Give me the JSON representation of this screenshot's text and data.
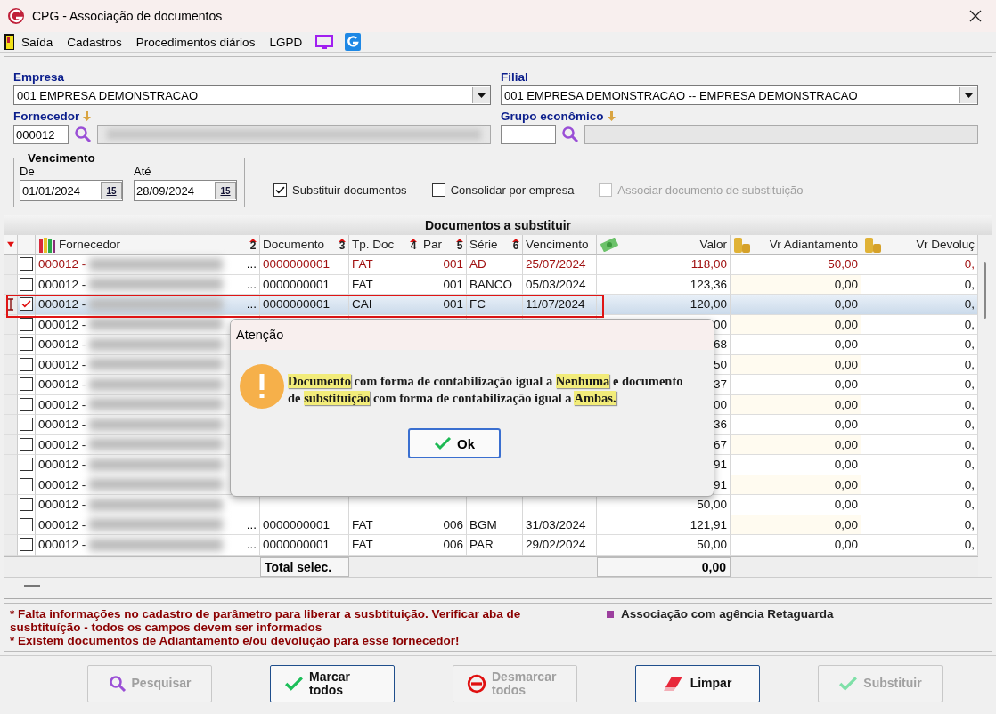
{
  "window": {
    "title": "CPG - Associação de documentos"
  },
  "menu": [
    {
      "label": "Saída"
    },
    {
      "label": "Cadastros"
    },
    {
      "label": "Procedimentos diários"
    },
    {
      "label": "LGPD"
    }
  ],
  "form": {
    "empresa": {
      "label": "Empresa",
      "value": "001 EMPRESA DEMONSTRACAO"
    },
    "filial": {
      "label": "Filial",
      "value": "001 EMPRESA DEMONSTRACAO -- EMPRESA DEMONSTRACAO"
    },
    "fornecedor": {
      "label": "Fornecedor",
      "code": "000012"
    },
    "grupo": {
      "label": "Grupo econômico"
    },
    "vencimento": {
      "title": "Vencimento",
      "de_label": "De",
      "de": "01/01/2024",
      "de_calendar": "15",
      "ate_label": "Até",
      "ate": "28/09/2024",
      "ate_calendar": "15"
    },
    "options": [
      {
        "label": "Substituir documentos",
        "checked": true,
        "disabled": false
      },
      {
        "label": "Consolidar por empresa",
        "checked": false,
        "disabled": false
      },
      {
        "label": "Associar documento de substituição",
        "checked": false,
        "disabled": true
      }
    ]
  },
  "grid": {
    "title": "Documentos a substituir",
    "columns": [
      {
        "label": "Fornecedor",
        "sort": "2"
      },
      {
        "label": "Documento",
        "sort": "3"
      },
      {
        "label": "Tp. Doc",
        "sort": "4"
      },
      {
        "label": "Par",
        "sort": "5"
      },
      {
        "label": "Série",
        "sort": "6"
      },
      {
        "label": "Vencimento"
      },
      {
        "label": "Valor"
      },
      {
        "label": "Vr Adiantamento"
      },
      {
        "label": "Vr Devoluç"
      }
    ],
    "rows": [
      {
        "checked": false,
        "selected": false,
        "alert": true,
        "fornecedor": "000012 -",
        "more": "...",
        "documento": "0000000001",
        "tp_doc": "FAT",
        "par": "001",
        "serie": "AD",
        "vencimento": "25/07/2024",
        "valor": "118,00",
        "vr_adiantamento": "50,00",
        "vr_devolucao": "0,"
      },
      {
        "checked": false,
        "selected": false,
        "alert": false,
        "fornecedor": "000012 -",
        "more": "...",
        "documento": "0000000001",
        "tp_doc": "FAT",
        "par": "001",
        "serie": "BANCO",
        "vencimento": "05/03/2024",
        "valor": "123,36",
        "vr_adiantamento": "0,00",
        "vr_devolucao": "0,"
      },
      {
        "checked": true,
        "selected": true,
        "alert": false,
        "fornecedor": "000012 -",
        "more": "...",
        "documento": "0000000001",
        "tp_doc": "CAI",
        "par": "001",
        "serie": "FC",
        "vencimento": "11/07/2024",
        "valor": "120,00",
        "vr_adiantamento": "0,00",
        "vr_devolucao": "0,"
      },
      {
        "checked": false,
        "selected": false,
        "alert": false,
        "fornecedor": "000012 -",
        "valor": "00",
        "vr_adiantamento": "0,00",
        "vr_devolucao": "0,"
      },
      {
        "checked": false,
        "selected": false,
        "alert": false,
        "fornecedor": "000012 -",
        "valor": "68",
        "vr_adiantamento": "0,00",
        "vr_devolucao": "0,"
      },
      {
        "checked": false,
        "selected": false,
        "alert": false,
        "fornecedor": "000012 -",
        "valor": "50",
        "vr_adiantamento": "0,00",
        "vr_devolucao": "0,"
      },
      {
        "checked": false,
        "selected": false,
        "alert": false,
        "fornecedor": "000012 -",
        "valor": "37",
        "vr_adiantamento": "0,00",
        "vr_devolucao": "0,"
      },
      {
        "checked": false,
        "selected": false,
        "alert": false,
        "fornecedor": "000012 -",
        "valor": "00",
        "vr_adiantamento": "0,00",
        "vr_devolucao": "0,"
      },
      {
        "checked": false,
        "selected": false,
        "alert": false,
        "fornecedor": "000012 -",
        "valor": "36",
        "vr_adiantamento": "0,00",
        "vr_devolucao": "0,"
      },
      {
        "checked": false,
        "selected": false,
        "alert": false,
        "fornecedor": "000012 -",
        "valor": "67",
        "vr_adiantamento": "0,00",
        "vr_devolucao": "0,"
      },
      {
        "checked": false,
        "selected": false,
        "alert": false,
        "fornecedor": "000012 -",
        "valor": "91",
        "vr_adiantamento": "0,00",
        "vr_devolucao": "0,"
      },
      {
        "checked": false,
        "selected": false,
        "alert": false,
        "fornecedor": "000012 -",
        "valor": "91",
        "vr_adiantamento": "0,00",
        "vr_devolucao": "0,"
      },
      {
        "checked": false,
        "selected": false,
        "alert": false,
        "fornecedor": "000012 -",
        "valor": "50,00",
        "vr_adiantamento": "0,00",
        "vr_devolucao": "0,"
      },
      {
        "checked": false,
        "selected": false,
        "alert": false,
        "fornecedor": "000012 -",
        "more": "...",
        "documento": "0000000001",
        "tp_doc": "FAT",
        "par": "006",
        "serie": "BGM",
        "vencimento": "31/03/2024",
        "valor": "121,91",
        "vr_adiantamento": "0,00",
        "vr_devolucao": "0,"
      },
      {
        "checked": false,
        "selected": false,
        "alert": false,
        "fornecedor": "000012 -",
        "more": "...",
        "documento": "0000000001",
        "tp_doc": "FAT",
        "par": "006",
        "serie": "PAR",
        "vencimento": "29/02/2024",
        "valor": "50,00",
        "vr_adiantamento": "0,00",
        "vr_devolucao": "0,"
      }
    ],
    "total_label": "Total selec.",
    "total": "0,00"
  },
  "messages": [
    "* Falta informações no cadastro de parâmetro para liberar a susbtituição. Verificar aba de susbtituíção - todos os campos devem ser informados",
    "* Existem documentos de Adiantamento e/ou devolução para esse fornecedor!"
  ],
  "legend": [
    {
      "label": "Associação com agência Retaguarda",
      "color": "#9c3f9e"
    }
  ],
  "buttons": [
    {
      "label": "Pesquisar",
      "disabled": true
    },
    {
      "label": "Marcar todos",
      "disabled": false
    },
    {
      "label": "Desmarcar todos",
      "disabled": true
    },
    {
      "label": "Limpar",
      "disabled": false
    },
    {
      "label": "Substituir",
      "disabled": true
    }
  ],
  "dialog": {
    "title": "Atenção",
    "message": [
      {
        "text": "Documento",
        "highlighted": true
      },
      {
        "text": " com forma de contabilização igual a ",
        "highlighted": false
      },
      {
        "text": "Nenhuma",
        "highlighted": true
      },
      {
        "text": " e documento de ",
        "highlighted": false
      },
      {
        "text": "substituição",
        "highlighted": true
      },
      {
        "text": " com forma de contabilização igual a ",
        "highlighted": false
      },
      {
        "text": "Ambas.",
        "highlighted": true
      }
    ],
    "button": "Ok"
  }
}
